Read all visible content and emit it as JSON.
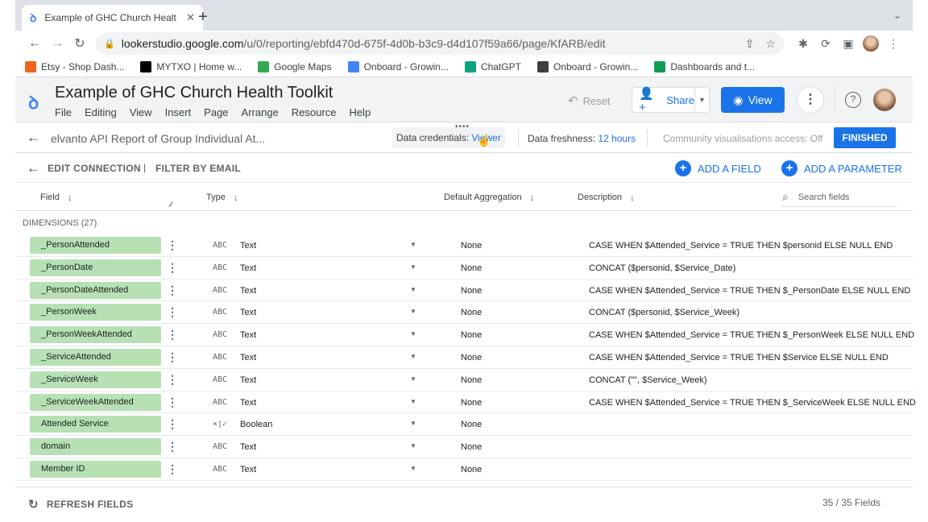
{
  "browser": {
    "tab_title": "Example of GHC Church Healt",
    "url_domain": "lookerstudio.google.com",
    "url_path": "/u/0/reporting/ebfd470d-675f-4d0b-b3c9-d4d107f59a66/page/KfARB/edit",
    "bookmarks": [
      {
        "label": "Etsy - Shop Dash...",
        "icon": "etsy-icon",
        "color": "#f1641e"
      },
      {
        "label": "MYTXO | Home w...",
        "icon": "mytxo-icon",
        "color": "#000000"
      },
      {
        "label": "Google Maps",
        "icon": "maps-icon",
        "color": "#34a853"
      },
      {
        "label": "Onboard - Growin...",
        "icon": "onboard-icon",
        "color": "#4285f4"
      },
      {
        "label": "ChatGPT",
        "icon": "chatgpt-icon",
        "color": "#10a37f"
      },
      {
        "label": "Onboard - Growin...",
        "icon": "onboard-icon",
        "color": "#3c4043"
      },
      {
        "label": "Dashboards and t...",
        "icon": "sheets-icon",
        "color": "#0f9d58"
      }
    ]
  },
  "header": {
    "report_title": "Example of GHC Church Health Toolkit",
    "menu": [
      "File",
      "Editing",
      "View",
      "Insert",
      "Page",
      "Arrange",
      "Resource",
      "Help"
    ],
    "reset_label": "Reset",
    "share_label": "Share",
    "view_label": "View"
  },
  "datasource": {
    "name": "elvanto API Report of Group Individual At...",
    "credentials_label": "Data credentials:",
    "credentials_value": "Viewer",
    "freshness_label": "Data freshness:",
    "freshness_value": "12 hours",
    "community_access": "Community visualisations access: Off",
    "finished_label": "FINISHED"
  },
  "edit": {
    "edit_connection": "EDIT CONNECTION",
    "filter_by_email": "FILTER BY EMAIL",
    "add_field": "ADD A FIELD",
    "add_parameter": "ADD A PARAMETER"
  },
  "table": {
    "headers": {
      "field": "Field",
      "type": "Type",
      "aggregation": "Default Aggregation",
      "description": "Description"
    },
    "search_placeholder": "Search fields",
    "dimensions_label": "DIMENSIONS (27)",
    "rows": [
      {
        "field": "_PersonAttended",
        "type_icon": "ABC",
        "type": "Text",
        "agg": "None",
        "desc": "CASE WHEN $Attended_Service = TRUE THEN $personid ELSE NULL END"
      },
      {
        "field": "_PersonDate",
        "type_icon": "ABC",
        "type": "Text",
        "agg": "None",
        "desc": "CONCAT ($personid, $Service_Date)"
      },
      {
        "field": "_PersonDateAttended",
        "type_icon": "ABC",
        "type": "Text",
        "agg": "None",
        "desc": "CASE WHEN $Attended_Service = TRUE THEN $_PersonDate ELSE NULL END"
      },
      {
        "field": "_PersonWeek",
        "type_icon": "ABC",
        "type": "Text",
        "agg": "None",
        "desc": "CONCAT ($personid, $Service_Week)"
      },
      {
        "field": "_PersonWeekAttended",
        "type_icon": "ABC",
        "type": "Text",
        "agg": "None",
        "desc": "CASE WHEN $Attended_Service = TRUE THEN $_PersonWeek ELSE NULL END"
      },
      {
        "field": "_ServiceAttended",
        "type_icon": "ABC",
        "type": "Text",
        "agg": "None",
        "desc": "CASE WHEN $Attended_Service = TRUE THEN $Service ELSE NULL END"
      },
      {
        "field": "_ServiceWeek",
        "type_icon": "ABC",
        "type": "Text",
        "agg": "None",
        "desc": "CONCAT (\"\", $Service_Week)"
      },
      {
        "field": "_ServiceWeekAttended",
        "type_icon": "ABC",
        "type": "Text",
        "agg": "None",
        "desc": "CASE WHEN $Attended_Service = TRUE THEN $_ServiceWeek ELSE NULL END"
      },
      {
        "field": "Attended Service",
        "type_icon": "×|✓",
        "type": "Boolean",
        "agg": "None",
        "desc": ""
      },
      {
        "field": "domain",
        "type_icon": "ABC",
        "type": "Text",
        "agg": "None",
        "desc": ""
      },
      {
        "field": "Member ID",
        "type_icon": "ABC",
        "type": "Text",
        "agg": "None",
        "desc": ""
      }
    ]
  },
  "footer": {
    "refresh_label": "REFRESH FIELDS",
    "count": "35 / 35 Fields"
  }
}
